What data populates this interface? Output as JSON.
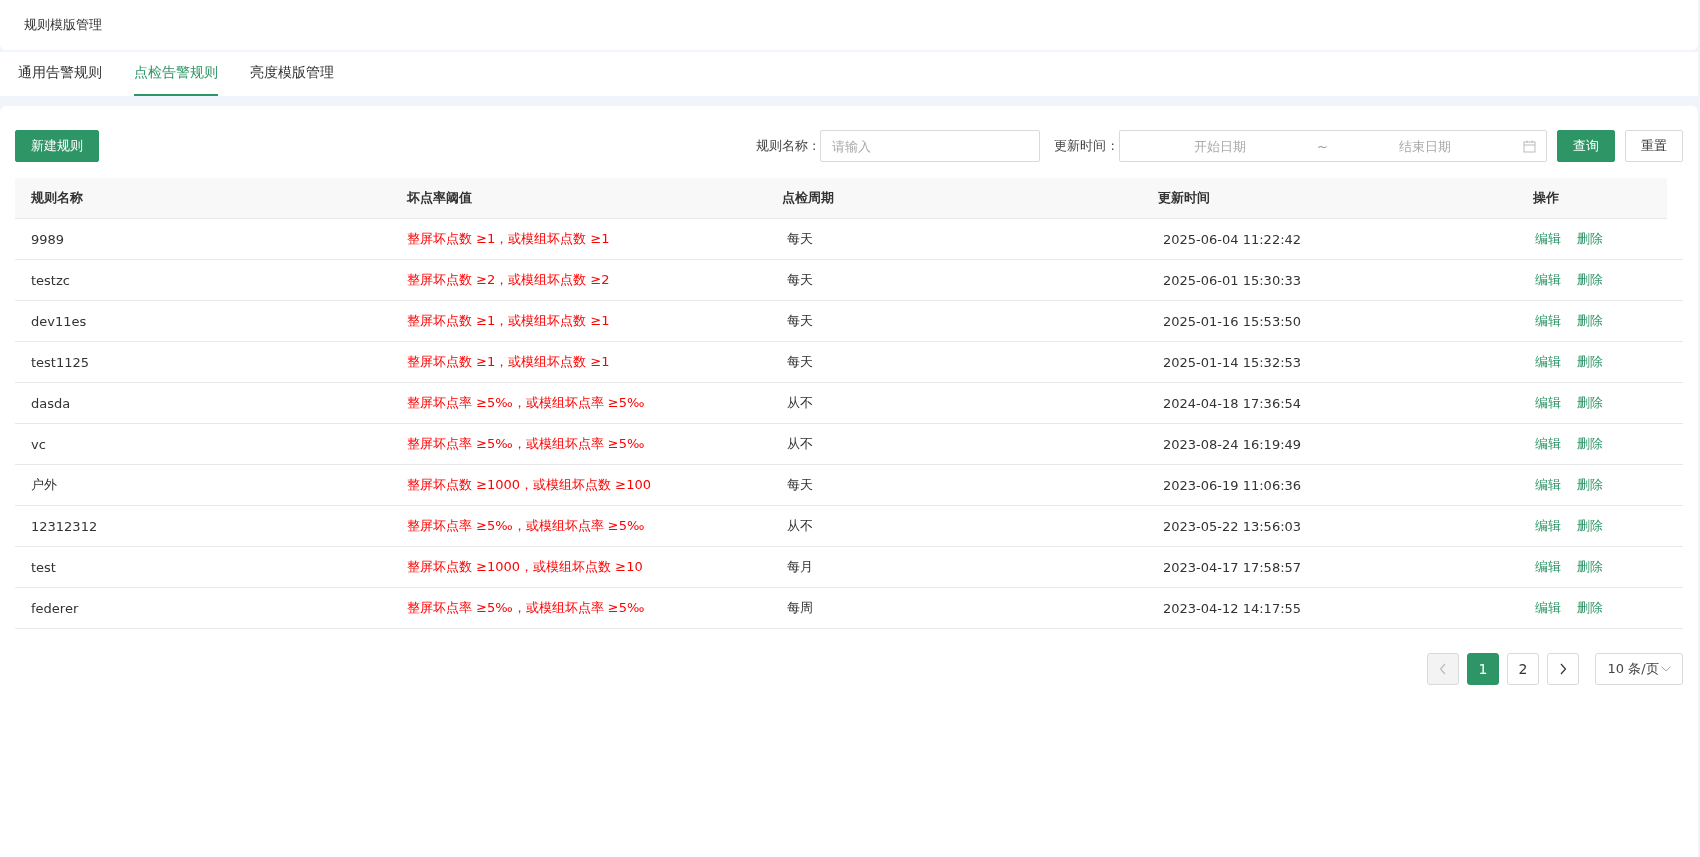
{
  "header": {
    "title": "规则模版管理"
  },
  "tabs": [
    {
      "label": "通用告警规则",
      "selected": false
    },
    {
      "label": "点检告警规则",
      "selected": true
    },
    {
      "label": "亮度模版管理",
      "selected": false
    }
  ],
  "toolbar": {
    "new_button": "新建规则",
    "name_label": "规则名称 :",
    "name_field": {
      "placeholder": "请输入"
    },
    "time_label": "更新时间 :",
    "start_date": {
      "placeholder": "开始日期"
    },
    "separator": "~",
    "end_date": {
      "placeholder": "结束日期"
    },
    "query_button": "查询",
    "reset_button": "重置"
  },
  "table": {
    "columns": [
      "规则名称",
      "坏点率阈值",
      "点检周期",
      "更新时间",
      "操作"
    ],
    "rows": [
      {
        "name": "9989",
        "threshold": "整屏坏点数 ≥1，或模组坏点数 ≥1",
        "period": "每天",
        "updated": "2025-06-04 11:22:42",
        "actions": [
          "编辑",
          "删除"
        ]
      },
      {
        "name": "testzc",
        "threshold": "整屏坏点数 ≥2，或模组坏点数 ≥2",
        "period": "每天",
        "updated": "2025-06-01 15:30:33",
        "actions": [
          "编辑",
          "删除"
        ]
      },
      {
        "name": "dev11es",
        "threshold": "整屏坏点数 ≥1，或模组坏点数 ≥1",
        "period": "每天",
        "updated": "2025-01-16 15:53:50",
        "actions": [
          "编辑",
          "删除"
        ]
      },
      {
        "name": "test1125",
        "threshold": "整屏坏点数 ≥1，或模组坏点数 ≥1",
        "period": "每天",
        "updated": "2025-01-14 15:32:53",
        "actions": [
          "编辑",
          "删除"
        ]
      },
      {
        "name": "dasda",
        "threshold": "整屏坏点率 ≥5‰，或模组坏点率 ≥5‰",
        "period": "从不",
        "updated": "2024-04-18 17:36:54",
        "actions": [
          "编辑",
          "删除"
        ]
      },
      {
        "name": "vc",
        "threshold": "整屏坏点率 ≥5‰，或模组坏点率 ≥5‰",
        "period": "从不",
        "updated": "2023-08-24 16:19:49",
        "actions": [
          "编辑",
          "删除"
        ]
      },
      {
        "name": "户外",
        "threshold": "整屏坏点数 ≥1000，或模组坏点数 ≥100",
        "period": "每天",
        "updated": "2023-06-19 11:06:36",
        "actions": [
          "编辑",
          "删除"
        ]
      },
      {
        "name": "12312312",
        "threshold": "整屏坏点率 ≥5‰，或模组坏点率 ≥5‰",
        "period": "从不",
        "updated": "2023-05-22 13:56:03",
        "actions": [
          "编辑",
          "删除"
        ]
      },
      {
        "name": "test",
        "threshold": "整屏坏点数 ≥1000，或模组坏点数 ≥10",
        "period": "每月",
        "updated": "2023-04-17 17:58:57",
        "actions": [
          "编辑",
          "删除"
        ]
      },
      {
        "name": "federer",
        "threshold": "整屏坏点率 ≥5‰，或模组坏点率 ≥5‰",
        "period": "每周",
        "updated": "2023-04-12 14:17:55",
        "actions": [
          "编辑",
          "删除"
        ]
      }
    ]
  },
  "pagination": {
    "prev": {
      "disabled": true
    },
    "pages": [
      {
        "label": "1",
        "selected": true
      },
      {
        "label": "2",
        "selected": false
      }
    ],
    "next": {
      "disabled": false
    },
    "page_size": "10 条/页"
  }
}
